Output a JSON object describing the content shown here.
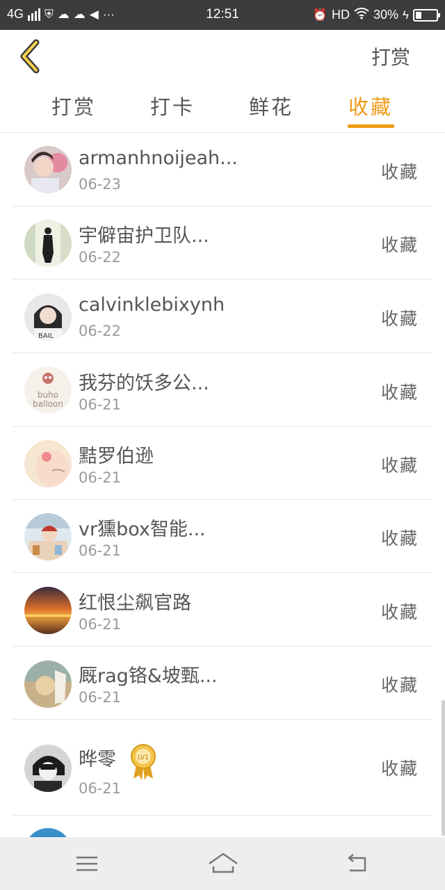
{
  "status_bar": {
    "network": "4G",
    "time": "12:51",
    "hd": "HD",
    "battery": "30%",
    "battery_level": 0.3,
    "icons": [
      "signal-icon",
      "shield-icon",
      "cloud-icon",
      "mute-icon",
      "more-icon",
      "alarm-icon",
      "wifi-icon",
      "battery-icon",
      "charging-icon"
    ]
  },
  "header": {
    "action_label": "打赏",
    "tabs": [
      {
        "label": "打赏"
      },
      {
        "label": "打卡"
      },
      {
        "label": "鲜花"
      },
      {
        "label": "收藏",
        "active": true
      }
    ]
  },
  "list": {
    "items": [
      {
        "name": "armanhnoijeah...",
        "date": "06-23",
        "action": "收藏"
      },
      {
        "name": "宇僻宙护卫队...",
        "date": "06-22",
        "action": "收藏"
      },
      {
        "name": "calvinklebixynh",
        "date": "06-22",
        "action": "收藏"
      },
      {
        "name": "我芬的饫多公...",
        "date": "06-21",
        "action": "收藏",
        "avatar_text": [
          "buho",
          "balloon"
        ]
      },
      {
        "name": "黠罗伯逊",
        "date": "06-21",
        "action": "收藏"
      },
      {
        "name": "vr獯box智能...",
        "date": "06-21",
        "action": "收藏"
      },
      {
        "name": "红恨尘飙官路",
        "date": "06-21",
        "action": "收藏"
      },
      {
        "name": "厩rag铬&坡甄...",
        "date": "06-21",
        "action": "收藏"
      },
      {
        "name": "晔零",
        "date": "06-21",
        "action": "收藏",
        "badge": "LV1"
      }
    ]
  },
  "colors": {
    "accent": "#f19a16",
    "status_bar": "#3c3c3c",
    "nav_bar": "#eeeeee"
  }
}
